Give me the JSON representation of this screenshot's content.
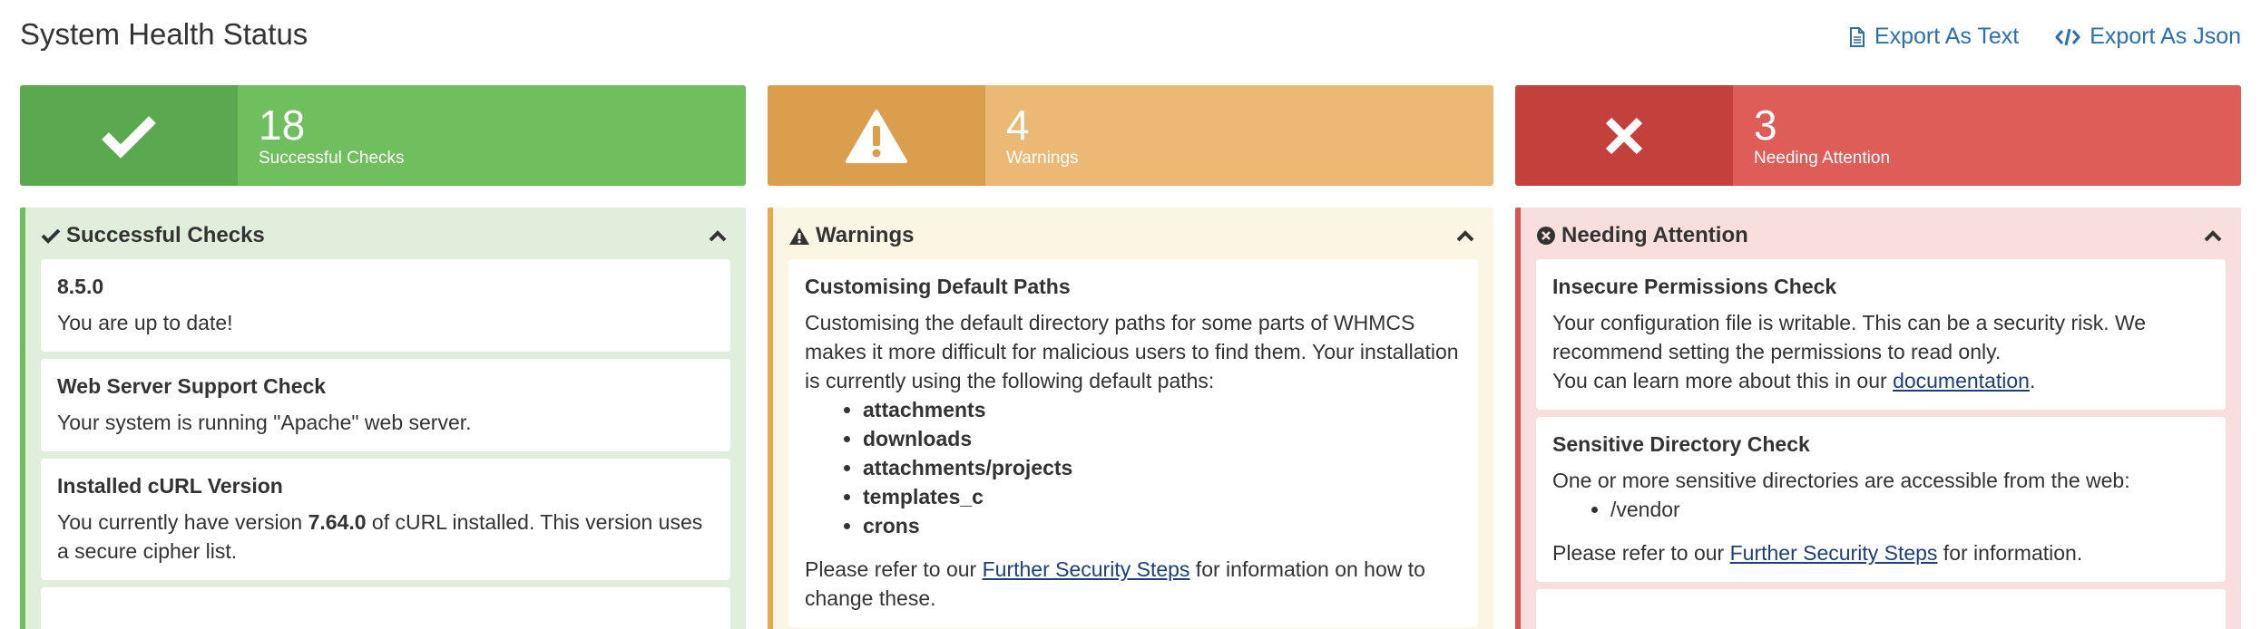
{
  "page": {
    "title": "System Health Status",
    "export_text": "Export As Text",
    "export_json": "Export As Json"
  },
  "summary": {
    "success_count": "18",
    "success_label": "Successful Checks",
    "warning_count": "4",
    "warning_label": "Warnings",
    "danger_count": "3",
    "danger_label": "Needing Attention"
  },
  "colors": {
    "success": "#70bf5e",
    "warning": "#ebb974",
    "danger": "#df5d59",
    "link": "#2a6fb0"
  },
  "successful": {
    "title": "Successful Checks",
    "checks": [
      {
        "title": "8.5.0",
        "body": "You are up to date!"
      },
      {
        "title": "Web Server Support Check",
        "body": "Your system is running \"Apache\" web server."
      },
      {
        "title": "Installed cURL Version",
        "body_pre": "You currently have version ",
        "body_bold": "7.64.0",
        "body_post": " of cURL installed. This version uses a secure cipher list."
      }
    ]
  },
  "warnings": {
    "title": "Warnings",
    "checks": [
      {
        "title": "Customising Default Paths",
        "body": "Customising the default directory paths for some parts of WHMCS makes it more difficult for malicious users to find them. Your installation is currently using the following default paths:",
        "paths": [
          "attachments",
          "downloads",
          "attachments/projects",
          "templates_c",
          "crons"
        ],
        "footer_pre": "Please refer to our ",
        "footer_link": "Further Security Steps",
        "footer_post": " for information on how to change these."
      }
    ]
  },
  "attention": {
    "title": "Needing Attention",
    "checks": [
      {
        "title": "Insecure Permissions Check",
        "body": "Your configuration file is writable. This can be a security risk. We recommend setting the permissions to read only.",
        "more_pre": "You can learn more about this in our ",
        "more_link": "documentation",
        "more_post": "."
      },
      {
        "title": "Sensitive Directory Check",
        "body": "One or more sensitive directories are accessible from the web:",
        "dirs": [
          "/vendor"
        ],
        "footer_pre": "Please refer to our ",
        "footer_link": "Further Security Steps",
        "footer_post": " for information."
      }
    ]
  }
}
